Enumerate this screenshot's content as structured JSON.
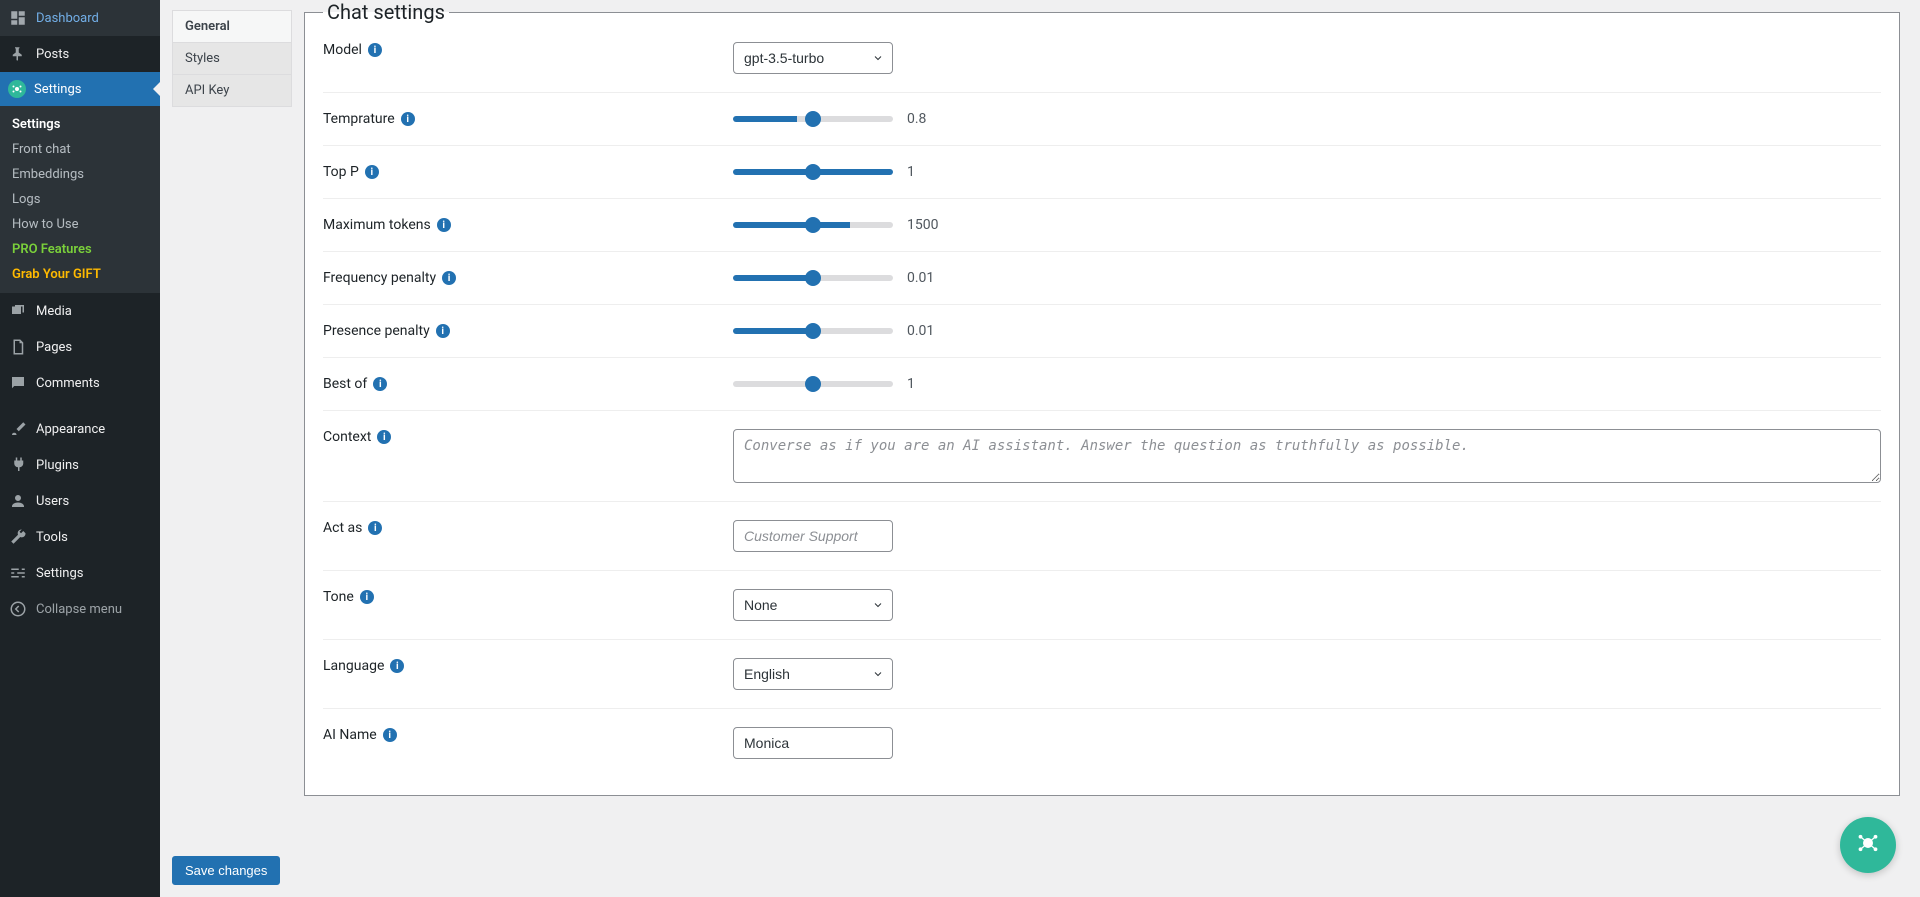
{
  "sidebar": {
    "items": [
      {
        "label": "Dashboard",
        "icon": "dashboard"
      },
      {
        "label": "Posts",
        "icon": "pin"
      },
      {
        "label": "Settings",
        "icon": "plugin",
        "current": true
      },
      {
        "label": "Media",
        "icon": "media"
      },
      {
        "label": "Pages",
        "icon": "pages"
      },
      {
        "label": "Comments",
        "icon": "comment"
      },
      {
        "label": "Appearance",
        "icon": "brush"
      },
      {
        "label": "Plugins",
        "icon": "plug"
      },
      {
        "label": "Users",
        "icon": "user"
      },
      {
        "label": "Tools",
        "icon": "wrench"
      },
      {
        "label": "Settings",
        "icon": "sliders"
      }
    ],
    "submenu": [
      {
        "label": "Settings",
        "style": "active"
      },
      {
        "label": "Front chat"
      },
      {
        "label": "Embeddings"
      },
      {
        "label": "Logs"
      },
      {
        "label": "How to Use"
      },
      {
        "label": "PRO Features",
        "style": "pro"
      },
      {
        "label": "Grab Your GIFT",
        "style": "gift"
      }
    ],
    "collapse": "Collapse menu"
  },
  "subnav": [
    {
      "label": "General",
      "active": true
    },
    {
      "label": "Styles"
    },
    {
      "label": "API Key"
    }
  ],
  "panel": {
    "title": "Chat settings",
    "fields": {
      "model": {
        "label": "Model",
        "value": "gpt-3.5-turbo"
      },
      "temperature": {
        "label": "Temprature",
        "value": 0.8,
        "min": 0,
        "max": 2
      },
      "top_p": {
        "label": "Top P",
        "value": 1,
        "min": 0,
        "max": 1
      },
      "max_tokens": {
        "label": "Maximum tokens",
        "value": 1500,
        "min": 0,
        "max": 2048
      },
      "freq_penalty": {
        "label": "Frequency penalty",
        "value": 0.01,
        "min": -2,
        "max": 2
      },
      "pres_penalty": {
        "label": "Presence penalty",
        "value": 0.01,
        "min": -2,
        "max": 2
      },
      "best_of": {
        "label": "Best of",
        "value": 1,
        "min": 1,
        "max": 20
      },
      "context": {
        "label": "Context",
        "placeholder": "Converse as if you are an AI assistant. Answer the question as truthfully as possible."
      },
      "act_as": {
        "label": "Act as",
        "placeholder": "Customer Support"
      },
      "tone": {
        "label": "Tone",
        "value": "None"
      },
      "language": {
        "label": "Language",
        "value": "English"
      },
      "ai_name": {
        "label": "AI Name",
        "value": "Monica"
      }
    }
  },
  "save_button": "Save changes"
}
